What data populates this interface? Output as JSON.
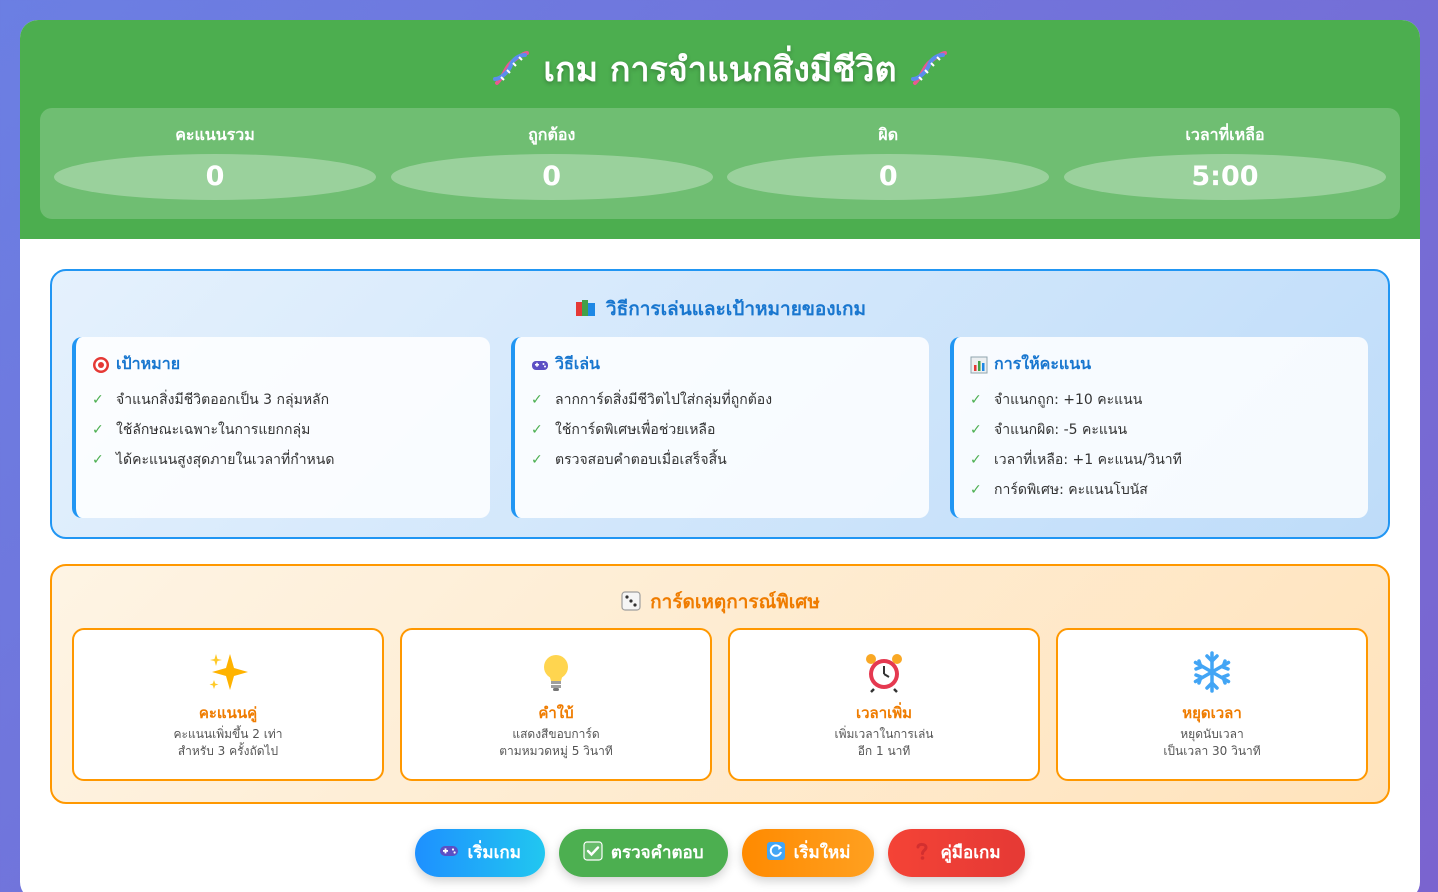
{
  "header": {
    "title": "เกม การจำแนกสิ่งมีชีวิต",
    "icon": "dna-icon",
    "stats": [
      {
        "label": "คะแนนรวม",
        "value": "0"
      },
      {
        "label": "ถูกต้อง",
        "value": "0"
      },
      {
        "label": "ผิด",
        "value": "0"
      },
      {
        "label": "เวลาที่เหลือ",
        "value": "5:00"
      }
    ]
  },
  "rules": {
    "title": "วิธีการเล่นและเป้าหมายของเกม",
    "icon": "books-icon",
    "cards": [
      {
        "title": "เป้าหมาย",
        "icon": "target-icon",
        "items": [
          "จำแนกสิ่งมีชีวิตออกเป็น 3 กลุ่มหลัก",
          "ใช้ลักษณะเฉพาะในการแยกกลุ่ม",
          "ได้คะแนนสูงสุดภายในเวลาที่กำหนด"
        ]
      },
      {
        "title": "วิธีเล่น",
        "icon": "gamepad-icon",
        "items": [
          "ลากการ์ดสิ่งมีชีวิตไปใส่กลุ่มที่ถูกต้อง",
          "ใช้การ์ดพิเศษเพื่อช่วยเหลือ",
          "ตรวจสอบคำตอบเมื่อเสร็จสิ้น"
        ]
      },
      {
        "title": "การให้คะแนน",
        "icon": "bar-chart-icon",
        "items": [
          "จำแนกถูก: +10 คะแนน",
          "จำแนกผิด: -5 คะแนน",
          "เวลาที่เหลือ: +1 คะแนน/วินาที",
          "การ์ดพิเศษ: คะแนนโบนัส"
        ]
      }
    ],
    "check_mark": "✓"
  },
  "events": {
    "title": "การ์ดเหตุการณ์พิเศษ",
    "icon": "dice-icon",
    "cards": [
      {
        "name": "คะแนนคู่",
        "icon": "sparkles-icon",
        "desc1": "คะแนนเพิ่มขึ้น 2 เท่า",
        "desc2": "สำหรับ 3 ครั้งถัดไป"
      },
      {
        "name": "คำใบ้",
        "icon": "lightbulb-icon",
        "desc1": "แสดงสีขอบการ์ด",
        "desc2": "ตามหมวดหมู่ 5 วินาที"
      },
      {
        "name": "เวลาเพิ่ม",
        "icon": "alarm-clock-icon",
        "desc1": "เพิ่มเวลาในการเล่น",
        "desc2": "อีก 1 นาที"
      },
      {
        "name": "หยุดเวลา",
        "icon": "snowflake-icon",
        "desc1": "หยุดนับเวลา",
        "desc2": "เป็นเวลา 30 วินาที"
      }
    ]
  },
  "buttons": {
    "start": "เริ่มเกม",
    "check": "ตรวจคำตอบ",
    "reset": "เริ่มใหม่",
    "guide": "คู่มือเกม"
  },
  "colors": {
    "header_green": "#4cae4f",
    "rules_blue": "#2196f3",
    "events_orange": "#ff9800",
    "check_green": "#4caf50"
  }
}
